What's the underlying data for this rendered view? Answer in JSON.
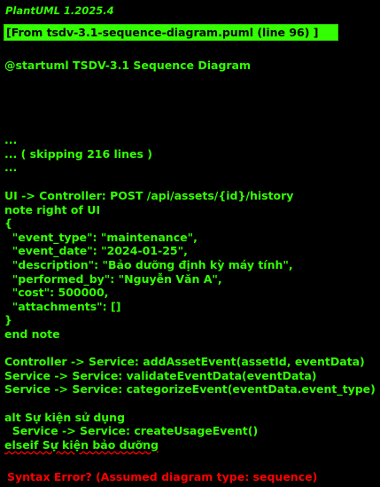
{
  "header": {
    "version": "PlantUML 1.2025.4",
    "source": "[From tsdv-3.1-sequence-diagram.puml (line 96) ]"
  },
  "code": {
    "startuml": "@startuml TSDV-3.1 Sequence Diagram",
    "skip_lines": [
      "...",
      "... ( skipping 216 lines )",
      "..."
    ],
    "lines": [
      "UI -> Controller: POST /api/assets/{id}/history",
      "note right of UI",
      "{",
      "  \"event_type\": \"maintenance\",",
      "  \"event_date\": \"2024-01-25\",",
      "  \"description\": \"Bảo dưỡng định kỳ máy tính\",",
      "  \"performed_by\": \"Nguyễn Văn A\",",
      "  \"cost\": 500000,",
      "  \"attachments\": []",
      "}",
      "end note",
      "",
      "Controller -> Service: addAssetEvent(assetId, eventData)",
      "Service -> Service: validateEventData(eventData)",
      "Service -> Service: categorizeEvent(eventData.event_type)",
      "",
      "alt Sự kiện sử dụng",
      "  Service -> Service: createUsageEvent()"
    ],
    "error_line": "elseif Sự kiện bảo dưỡng"
  },
  "error": {
    "message": " Syntax Error? (Assumed diagram type: sequence)"
  },
  "colors": {
    "background": "#000000",
    "text": "#33FF02",
    "banner": "#33FF02",
    "error": "#FF0000"
  }
}
